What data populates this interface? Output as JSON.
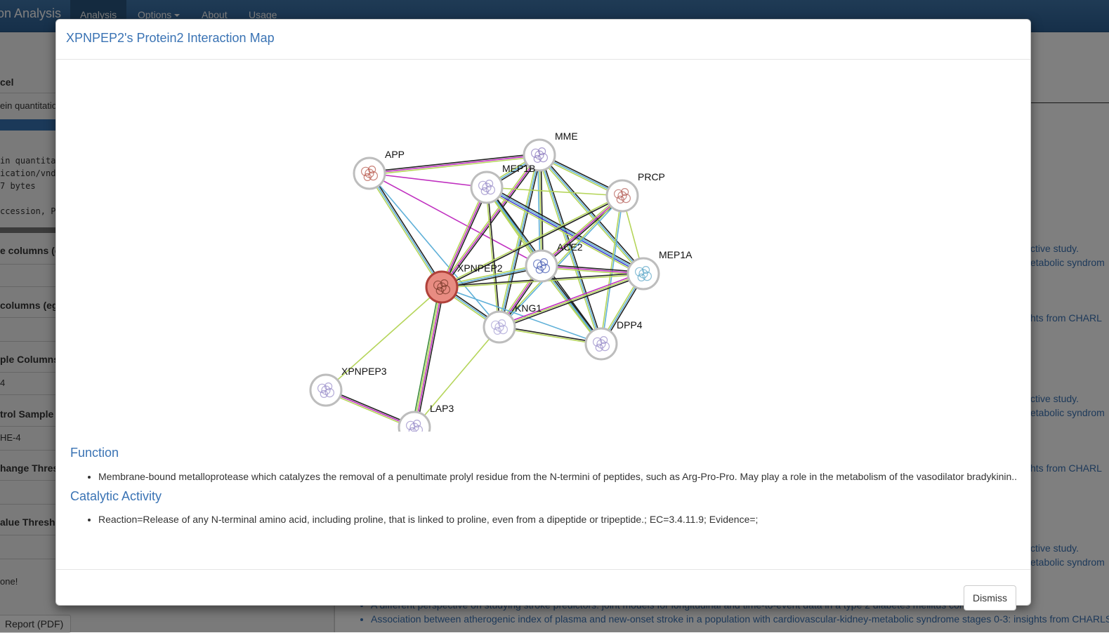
{
  "navbar": {
    "brand": "on Analysis",
    "items": [
      {
        "label": "Analysis"
      },
      {
        "label": "Options"
      },
      {
        "label": "About"
      },
      {
        "label": "Usage"
      }
    ]
  },
  "background": {
    "left_labels": {
      "panel": "cel",
      "quant": "ein quantitatio",
      "mono_lines": [
        "in quantita",
        "ication/vnd",
        "7 bytes",
        "",
        "ccession, P"
      ],
      "columns_e": "e columns (e",
      "columns_eg": "columns (eg",
      "sample_columns": "ple Columns",
      "sample_val": "4",
      "control_sample": "trol Sample C",
      "control_val": "HE-4",
      "change_thresh": "hange Thresh",
      "value_thresh": "alue Thresh",
      "done": "one!",
      "report_button": "Report (PDF)"
    },
    "right_links": [
      "ctive study.",
      "etabolic syndrom",
      "hts from CHARL",
      "ctive study.",
      "etabolic syndrom",
      "hts from CHARL",
      "ctive study.",
      "etabolic syndrom"
    ],
    "bottom_links": [
      "A different perspective on studying stroke predictors: joint models for longitudinal and time-to-event data in a type 2 diabetes mellitus cohort.",
      "Association between atherogenic index of plasma and new-onset stroke in a population with cardiovascular-kidney-metabolic syndrome stages 0-3: insights from CHARLS"
    ]
  },
  "modal": {
    "title": "XPNPEP2's Protein2 Interaction Map",
    "network": {
      "nodes": [
        {
          "id": "APP",
          "label": "APP",
          "color": "#b85a4e",
          "center": false
        },
        {
          "id": "MME",
          "label": "MME",
          "color": "#8c7bbf",
          "center": false
        },
        {
          "id": "MEP1B",
          "label": "MEP1B",
          "color": "#9a8ec9",
          "center": false
        },
        {
          "id": "PRCP",
          "label": "PRCP",
          "color": "#b5605a",
          "center": false
        },
        {
          "id": "ACE2",
          "label": "ACE2",
          "color": "#4a5fb5",
          "center": false
        },
        {
          "id": "XPNPEP2",
          "label": "XPNPEP2",
          "color": "#e4938a",
          "center": true
        },
        {
          "id": "MEP1A",
          "label": "MEP1A",
          "color": "#5fa8c8",
          "center": false
        },
        {
          "id": "KNG1",
          "label": "KNG1",
          "color": "#a9a3d6",
          "center": false
        },
        {
          "id": "DPP4",
          "label": "DPP4",
          "color": "#9a8ec9",
          "center": false
        },
        {
          "id": "XPNPEP3",
          "label": "XPNPEP3",
          "color": "#9a8ec9",
          "center": false
        },
        {
          "id": "LAP3",
          "label": "LAP3",
          "color": "#9a8ec9",
          "center": false
        }
      ],
      "edges": [
        [
          "APP",
          "MME",
          [
            "#222",
            "#c030c0",
            "#b5d55a"
          ]
        ],
        [
          "APP",
          "MEP1B",
          [
            "#c030c0"
          ]
        ],
        [
          "APP",
          "ACE2",
          [
            "#c030c0"
          ]
        ],
        [
          "APP",
          "XPNPEP2",
          [
            "#222",
            "#5fb0d8",
            "#b5d55a"
          ]
        ],
        [
          "APP",
          "KNG1",
          [
            "#5fb0d8"
          ]
        ],
        [
          "MME",
          "MEP1B",
          [
            "#222",
            "#5fb0d8",
            "#b5d55a"
          ]
        ],
        [
          "MME",
          "PRCP",
          [
            "#222",
            "#5fb0d8",
            "#b5d55a"
          ]
        ],
        [
          "MME",
          "ACE2",
          [
            "#222",
            "#b5d55a",
            "#5fb0d8"
          ]
        ],
        [
          "MME",
          "XPNPEP2",
          [
            "#222",
            "#c030c0",
            "#b5d55a"
          ]
        ],
        [
          "MME",
          "MEP1A",
          [
            "#222",
            "#5fb0d8",
            "#b5d55a"
          ]
        ],
        [
          "MME",
          "KNG1",
          [
            "#222",
            "#5fb0d8",
            "#b5d55a"
          ]
        ],
        [
          "MME",
          "DPP4",
          [
            "#222",
            "#5fb0d8",
            "#b5d55a"
          ]
        ],
        [
          "MEP1B",
          "ACE2",
          [
            "#222",
            "#5fb0d8",
            "#b5d55a"
          ]
        ],
        [
          "MEP1B",
          "XPNPEP2",
          [
            "#222",
            "#c030c0",
            "#b5d55a"
          ]
        ],
        [
          "MEP1B",
          "MEP1A",
          [
            "#222",
            "#5fb0d8",
            "#4040d0",
            "#b5d55a"
          ]
        ],
        [
          "MEP1B",
          "KNG1",
          [
            "#222",
            "#b5d55a"
          ]
        ],
        [
          "MEP1B",
          "DPP4",
          [
            "#222",
            "#5fb0d8",
            "#b5d55a"
          ]
        ],
        [
          "MEP1B",
          "PRCP",
          [
            "#b5d55a"
          ]
        ],
        [
          "PRCP",
          "ACE2",
          [
            "#222",
            "#c030c0",
            "#b5d55a"
          ]
        ],
        [
          "PRCP",
          "XPNPEP2",
          [
            "#222",
            "#b5d55a"
          ]
        ],
        [
          "PRCP",
          "MEP1A",
          [
            "#b5d55a"
          ]
        ],
        [
          "PRCP",
          "KNG1",
          [
            "#5fb0d8",
            "#b5d55a"
          ]
        ],
        [
          "PRCP",
          "DPP4",
          [
            "#5fb0d8",
            "#b5d55a"
          ]
        ],
        [
          "ACE2",
          "XPNPEP2",
          [
            "#222",
            "#5fb0d8",
            "#b5d55a"
          ]
        ],
        [
          "ACE2",
          "MEP1A",
          [
            "#222",
            "#c030c0",
            "#b5d55a"
          ]
        ],
        [
          "ACE2",
          "KNG1",
          [
            "#222",
            "#c030c0",
            "#b5d55a"
          ]
        ],
        [
          "ACE2",
          "DPP4",
          [
            "#222",
            "#5fb0d8",
            "#b5d55a"
          ]
        ],
        [
          "XPNPEP2",
          "MEP1A",
          [
            "#222",
            "#b5d55a"
          ]
        ],
        [
          "XPNPEP2",
          "KNG1",
          [
            "#222",
            "#5fb0d8",
            "#b5d55a"
          ]
        ],
        [
          "XPNPEP2",
          "DPP4",
          [
            "#5fb0d8"
          ]
        ],
        [
          "XPNPEP2",
          "XPNPEP3",
          [
            "#b5d55a"
          ]
        ],
        [
          "XPNPEP2",
          "LAP3",
          [
            "#222",
            "#c030c0",
            "#b5d55a",
            "#3a8a3a"
          ]
        ],
        [
          "MEP1A",
          "KNG1",
          [
            "#222",
            "#b5d55a",
            "#c030c0"
          ]
        ],
        [
          "MEP1A",
          "DPP4",
          [
            "#222",
            "#5fb0d8",
            "#b5d55a"
          ]
        ],
        [
          "KNG1",
          "DPP4",
          [
            "#222",
            "#b5d55a"
          ]
        ],
        [
          "KNG1",
          "LAP3",
          [
            "#b5d55a"
          ]
        ],
        [
          "XPNPEP3",
          "LAP3",
          [
            "#222",
            "#c030c0",
            "#b5d55a"
          ]
        ]
      ]
    },
    "function_heading": "Function",
    "function_items": [
      "Membrane-bound metalloprotease which catalyzes the removal of a penultimate prolyl residue from the N-termini of peptides, such as Arg-Pro-Pro. May play a role in the metabolism of the vasodilator bradykinin.."
    ],
    "catalytic_heading": "Catalytic Activity",
    "catalytic_items": [
      "Reaction=Release of any N-terminal amino acid, including proline, that is linked to proline, even from a dipeptide or tripeptide.; EC=3.4.11.9; Evidence=;"
    ],
    "dismiss_label": "Dismiss"
  }
}
